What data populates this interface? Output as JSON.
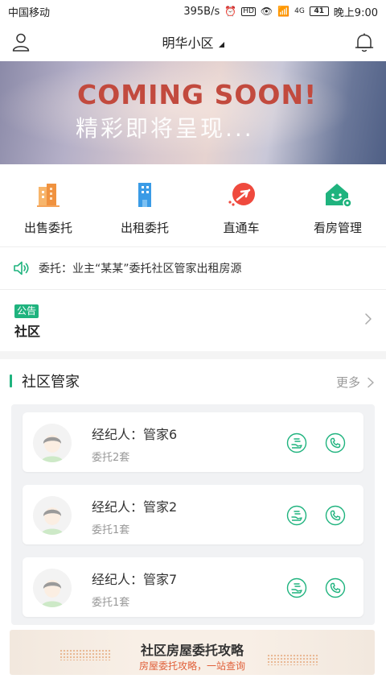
{
  "status_bar": {
    "carrier": "中国移动",
    "speed": "395B/s",
    "network": "4G",
    "battery": "41",
    "time": "晚上9:00"
  },
  "header": {
    "title": "明华小区",
    "left_icon": "user-icon",
    "right_icon": "bell-icon"
  },
  "banner": {
    "line1": "COMING SOON!",
    "line2": "精彩即将呈现..."
  },
  "quick_entries": [
    {
      "label": "出售委托",
      "icon": "building-sale-icon",
      "color": "#f5a45a"
    },
    {
      "label": "出租委托",
      "icon": "building-rent-icon",
      "color": "#3a9be6"
    },
    {
      "label": "直通车",
      "icon": "plane-icon",
      "color": "#ef4a3e"
    },
    {
      "label": "看房管理",
      "icon": "house-gear-icon",
      "color": "#1fb37e"
    }
  ],
  "notice": {
    "text": "委托：业主“某某”委托社区管家出租房源"
  },
  "announcement": {
    "badge": "公告",
    "title": "社区"
  },
  "section": {
    "title": "社区管家",
    "more": "更多"
  },
  "agents": [
    {
      "name": "经纪人：管家6",
      "count": "委托2套"
    },
    {
      "name": "经纪人：管家2",
      "count": "委托1套"
    },
    {
      "name": "经纪人：管家7",
      "count": "委托1套"
    }
  ],
  "guide": {
    "title": "社区房屋委托攻略",
    "subtitle": "房屋委托攻略，一站查询"
  },
  "colors": {
    "accent": "#1fb37e",
    "orange": "#e0603a"
  }
}
